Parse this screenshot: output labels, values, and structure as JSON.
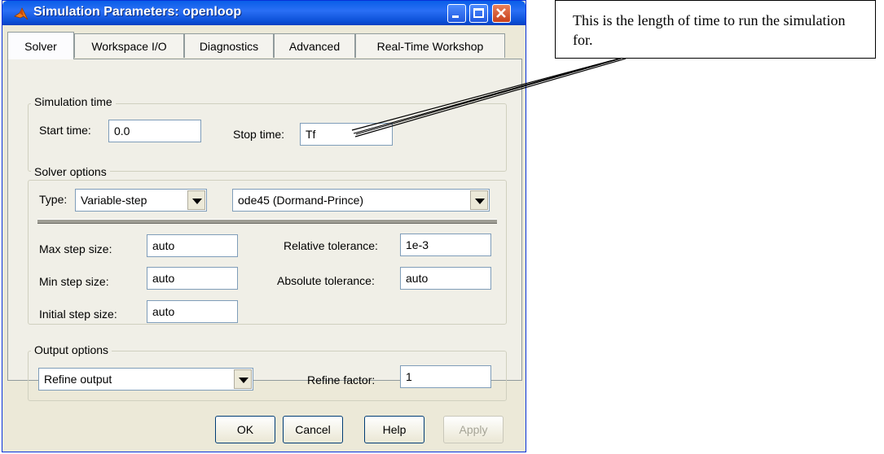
{
  "window": {
    "title": "Simulation Parameters: openloop",
    "title_icon": "matlab-logo-icon"
  },
  "tabs": [
    "Solver",
    "Workspace I/O",
    "Diagnostics",
    "Advanced",
    "Real-Time Workshop"
  ],
  "simulation_time": {
    "legend": "Simulation time",
    "start_label": "Start time:",
    "start_value": "0.0",
    "stop_label": "Stop time:",
    "stop_value": "Tf"
  },
  "solver_options": {
    "legend": "Solver options",
    "type_label": "Type:",
    "type_value": "Variable-step",
    "solver_value": "ode45 (Dormand-Prince)",
    "max_step_label": "Max step size:",
    "max_step_value": "auto",
    "min_step_label": "Min step size:",
    "min_step_value": "auto",
    "initial_step_label": "Initial step size:",
    "initial_step_value": "auto",
    "rel_tol_label": "Relative tolerance:",
    "rel_tol_value": "1e-3",
    "abs_tol_label": "Absolute tolerance:",
    "abs_tol_value": "auto"
  },
  "output_options": {
    "legend": "Output options",
    "output_value": "Refine output",
    "refine_label": "Refine factor:",
    "refine_value": "1"
  },
  "buttons": {
    "ok": "OK",
    "cancel": "Cancel",
    "help": "Help",
    "apply": "Apply"
  },
  "callout": {
    "text": "This is the length of time to run the simulation for."
  },
  "colors": {
    "titlebar": "#0a5ee8",
    "dialog_bg": "#ece9d8",
    "close_button": "#c8401c"
  }
}
